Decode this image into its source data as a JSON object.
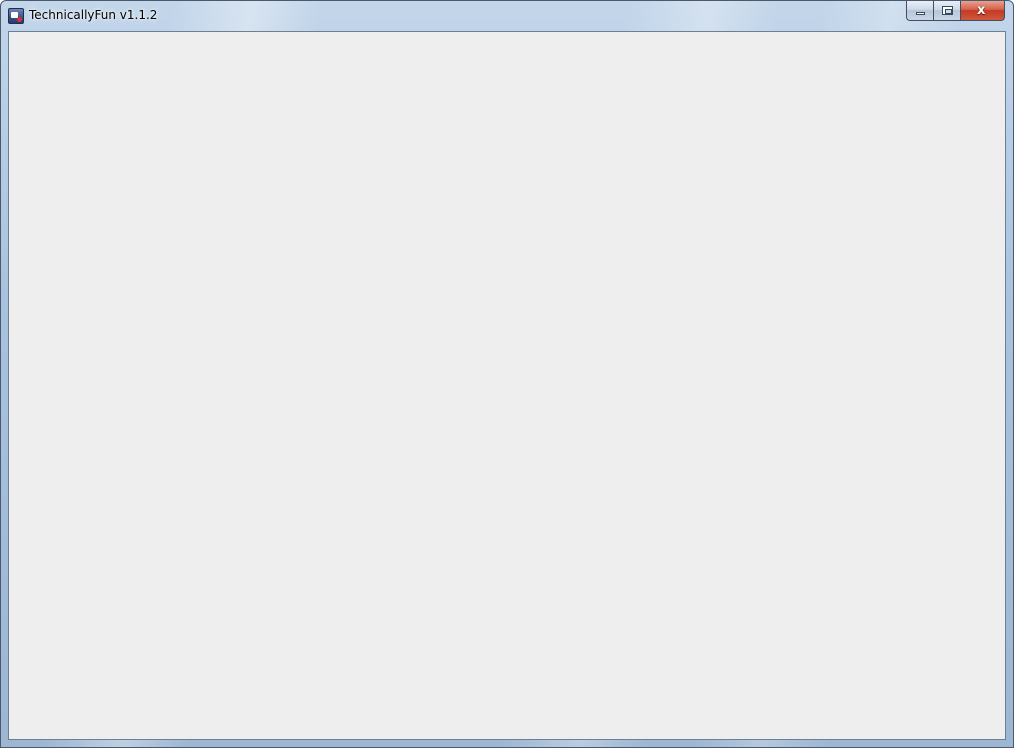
{
  "window": {
    "title": "TechnicallyFun v1.1.2",
    "icon": "app-icon",
    "controls": {
      "minimize_icon": "minimize-icon",
      "maximize_icon": "maximize-icon",
      "close_icon": "close-icon",
      "close_glyph": "x"
    },
    "colors": {
      "client_background": "#eeeeee",
      "close_button": "#c23b22",
      "frame": "#a9c2dd"
    }
  }
}
